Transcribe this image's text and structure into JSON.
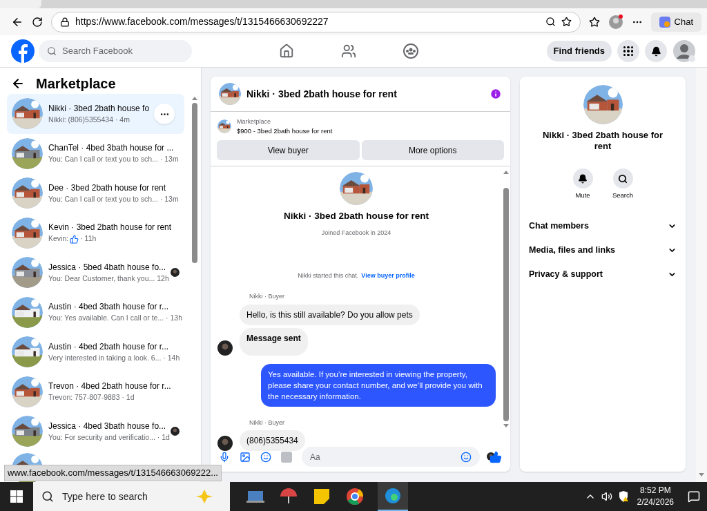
{
  "browser": {
    "url": "https://www.facebook.com/messages/t/1315466630692227",
    "chat_button": "Chat"
  },
  "header": {
    "search_placeholder": "Search Facebook",
    "find_friends": "Find friends"
  },
  "sidebar": {
    "title": "Marketplace",
    "items": [
      {
        "title": "Nikki · 3bed 2bath house fo",
        "preview": "Nikki: (806)5355434 · 4m",
        "selected": true,
        "seen": false,
        "like": false
      },
      {
        "title": "ChanTel · 4bed 3bath house for ...",
        "preview": "You: Can I call or text you to sch...  · 13m",
        "selected": false,
        "seen": false,
        "like": false
      },
      {
        "title": "Dee · 3bed 2bath house for rent",
        "preview": "You: Can I call or text you to sch...  · 13m",
        "selected": false,
        "seen": false,
        "like": false
      },
      {
        "title": "Kevin · 3bed 2bath house for rent",
        "preview": "Kevin:",
        "time": " · 11h",
        "selected": false,
        "seen": false,
        "like": true
      },
      {
        "title": "Jessica · 5bed 4bath house fo...",
        "preview": "You: Dear Customer, thank you... 12h",
        "selected": false,
        "seen": true,
        "like": false
      },
      {
        "title": "Austin · 4bed 3bath house for r...",
        "preview": "You: Yes available. Can I call or te...  · 13h",
        "selected": false,
        "seen": false,
        "like": false
      },
      {
        "title": "Austin · 4bed 2bath house for r...",
        "preview": "Very interested in taking a look. 6... · 14h",
        "selected": false,
        "seen": false,
        "like": false
      },
      {
        "title": "Trevon · 4bed 2bath house for r...",
        "preview": "Trevon: 757-807-9883 · 1d",
        "selected": false,
        "seen": false,
        "like": false
      },
      {
        "title": "Jessica · 4bed 3bath house fo...",
        "preview": "You: For security and verificatio...  · 1d",
        "selected": false,
        "seen": true,
        "like": false
      }
    ]
  },
  "chat": {
    "title": "Nikki · 3bed 2bath house for rent",
    "listing_label": "Marketplace",
    "listing": "$900 - 3bed 2bath house for rent",
    "buttons": [
      "View buyer",
      "More options"
    ],
    "intro_name": "Nikki · 3bed 2bath house for rent",
    "joined": "Joined Facebook in 2024",
    "started": "Nikki started this chat.",
    "profile_link": "View buyer profile",
    "messages": [
      {
        "kind": "sender",
        "text": "Nikki · Buyer"
      },
      {
        "kind": "incoming",
        "text": "Hello, is this still available? Do you allow pets",
        "avatar": false
      },
      {
        "kind": "incoming_bold",
        "text": "Message sent",
        "avatar": true
      },
      {
        "kind": "outgoing",
        "text": "Yes available. If you’re interested in viewing the property, please share your contact number, and we’ll provide you with the necessary information."
      },
      {
        "kind": "sender",
        "text": "Nikki · Buyer"
      },
      {
        "kind": "incoming",
        "text": "(806)5355434",
        "avatar": true
      }
    ],
    "composer_placeholder": "Aa"
  },
  "details": {
    "name": "Nikki · 3bed 2bath house for rent",
    "actions": [
      "Mute",
      "Search"
    ],
    "sections": [
      "Chat members",
      "Media, files and links",
      "Privacy & support"
    ]
  },
  "status_link": "www.facebook.com/messages/t/131546663069222...",
  "taskbar": {
    "search_placeholder": "Type here to search",
    "time": "8:52 PM",
    "date": "2/24/2026"
  }
}
